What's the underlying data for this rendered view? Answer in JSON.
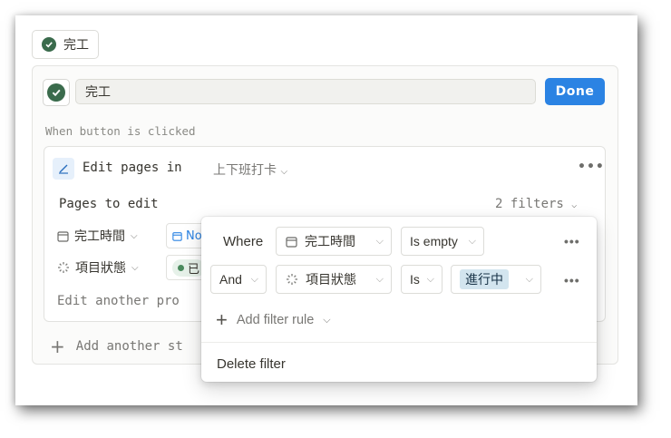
{
  "top_chip": {
    "label": "完工"
  },
  "editor": {
    "name_value": "完工",
    "done_label": "Done",
    "when_label": "When button is clicked"
  },
  "step": {
    "title": "Edit pages in",
    "database": "上下班打卡",
    "pages_to_edit": "Pages to edit",
    "filters_count": "2 filters",
    "prop1": "完工時間",
    "prop1_value": "No",
    "prop2": "項目狀態",
    "prop2_value": "已",
    "edit_another": "Edit another pro"
  },
  "add_step": "Add another st",
  "filter_popup": {
    "rows": [
      {
        "conjunction": "Where",
        "property": "完工時間",
        "operator": "Is empty",
        "value": ""
      },
      {
        "conjunction": "And",
        "property": "項目狀態",
        "operator": "Is",
        "value": "進行中"
      }
    ],
    "add_rule": "Add filter rule",
    "delete": "Delete filter"
  },
  "colors": {
    "accent": "#2b83e3",
    "check_green": "#3a6b4c",
    "tag_blue": "#d3e5ef"
  }
}
